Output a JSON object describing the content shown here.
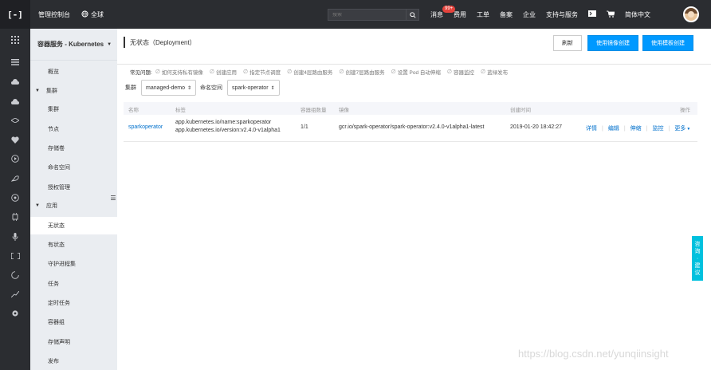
{
  "topbar": {
    "logo": "[-]",
    "console_label": "管理控制台",
    "region_label": "全球",
    "search_placeholder": "搜索",
    "nav": {
      "messages": "消息",
      "messages_badge": "99+",
      "billing": "费用",
      "tickets": "工单",
      "icp": "备案",
      "enterprise": "企业",
      "support": "支持与服务",
      "language": "简体中文"
    }
  },
  "rail_icons": [
    "grid-icon",
    "list-icon",
    "cloud-icon",
    "cloud-solid-icon",
    "compass-icon",
    "heart-icon",
    "play-circle-icon",
    "rocket-icon",
    "settings-circle-icon",
    "chip-icon",
    "microphone-icon",
    "bracket-icon",
    "spinner-icon",
    "chart-line-icon",
    "gear-icon"
  ],
  "sidebar": {
    "header": "容器服务 - Kubernetes",
    "overview": "概览",
    "cluster_group": "集群",
    "cluster_items": [
      "集群",
      "节点",
      "存储卷",
      "命名空间",
      "授权管理"
    ],
    "app_group": "应用",
    "app_items": [
      "无状态",
      "有状态",
      "守护进程集",
      "任务",
      "定时任务",
      "容器组",
      "存储声明",
      "发布"
    ],
    "active_item": "无状态"
  },
  "main": {
    "title": "无状态（Deployment）",
    "refresh_label": "刷新",
    "create_image_label": "使用镜像创建",
    "create_template_label": "使用模板创建",
    "faq_label": "常见问题:",
    "faq_links": [
      "如何支持私有镜像",
      "创建应用",
      "指定节点调度",
      "创建4层路由服务",
      "创建7层路由服务",
      "设置 Pod 自动伸缩",
      "容器监控",
      "蓝绿发布"
    ],
    "filter": {
      "cluster_label": "集群",
      "cluster_value": "managed-demo",
      "namespace_label": "命名空间",
      "namespace_value": "spark-operator"
    },
    "table": {
      "headers": {
        "name": "名称",
        "labels": "标签",
        "pods": "容器组数量",
        "image": "镜像",
        "created": "创建时间",
        "actions": "操作"
      },
      "rows": [
        {
          "name": "sparkoperator",
          "label1": "app.kubernetes.io/name:sparkoperator",
          "label2": "app.kubernetes.io/version:v2.4.0-v1alpha1",
          "pods": "1/1",
          "image": "gcr.io/spark-operator/spark-operator:v2.4.0-v1alpha1-latest",
          "created": "2019-01-20 18:42:27",
          "ops": {
            "details": "详情",
            "edit": "编辑",
            "scale": "伸缩",
            "monitor": "监控",
            "more": "更多"
          }
        }
      ]
    }
  },
  "float_tab": [
    "咨",
    "询",
    "·",
    "建",
    "议"
  ],
  "watermark": "https://blog.csdn.net/yunqiinsight",
  "colors": {
    "topbar": "#2b2d31",
    "sidebar": "#eaedf1",
    "primary": "#0099ff",
    "link": "#0070cc",
    "float_tab": "#00c1de",
    "badge": "#e5433c"
  }
}
